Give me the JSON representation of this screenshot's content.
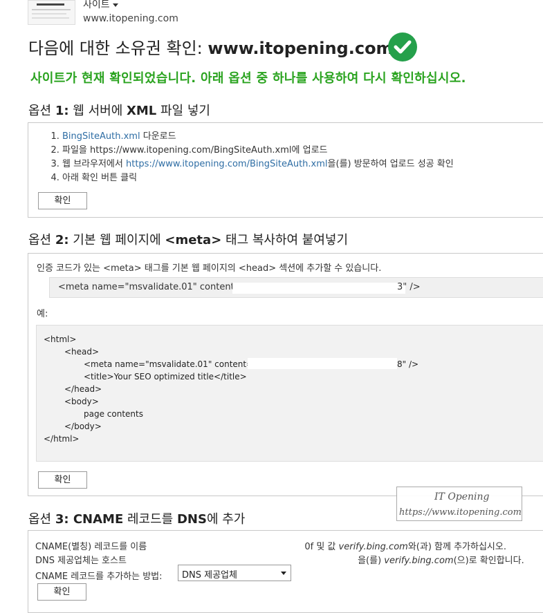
{
  "header": {
    "site_label": "사이트",
    "site_url": "www.itopening.com",
    "title_prefix": "다음에 대한 소유권 확인: ",
    "title_domain": "www.itopening.com",
    "banner": "사이트가 현재 확인되었습니다. 아래 옵션 중 하나를 사용하여 다시 확인하십시오."
  },
  "option1": {
    "heading_prefix": "옵션 ",
    "heading_num": "1:",
    "heading_text": " 웹 서버에 ",
    "heading_bold": "XML",
    "heading_suffix": " 파일 넣기",
    "step1_link": "BingSiteAuth.xml",
    "step1_text": " 다운로드",
    "step2": "파일을 https://www.itopening.com/BingSiteAuth.xml에 업로드",
    "step3_pre": "웹 브라우저에서 ",
    "step3_link": "https://www.itopening.com/BingSiteAuth.xml",
    "step3_post": "을(를) 방문하여 업로드 성공 확인",
    "step4": "아래 확인 버튼 클릭",
    "confirm": "확인"
  },
  "option2": {
    "heading_prefix": "옵션 ",
    "heading_num": "2:",
    "heading_text": " 기본 웹 페이지에 ",
    "heading_bold": "<meta>",
    "heading_suffix": " 태그 복사하여 붙여넣기",
    "intro": "인증 코드가 있는 <meta> 태그를 기본 웹 페이지의 <head> 섹션에 추가할 수 있습니다.",
    "meta_start": "<meta name=\"msvalidate.01\" content=\"",
    "meta_end": "3\" />",
    "example_label": "예:",
    "code": {
      "l1": "<html>",
      "l2": "<head>",
      "l3_start": "<meta name=\"msvalidate.01\" content=\"8",
      "l3_end": "8\" />",
      "l4": "<title>Your SEO optimized title</title>",
      "l5": "</head>",
      "l6": "<body>",
      "l7": "page contents",
      "l8": "</body>",
      "l9": "</html>"
    },
    "confirm": "확인"
  },
  "watermark": {
    "line1": "IT Opening",
    "line2": "https://www.itopening.com"
  },
  "option3": {
    "heading_prefix": "옵션 ",
    "heading_num": "3:",
    "heading_bold1": " CNAME",
    "heading_text": " 레코드를 ",
    "heading_bold2": "DNS",
    "heading_suffix": "에 추가",
    "line1_pre": "CNAME(별칭) 레코드를 이름 ",
    "line1_mid": "0f 및 값 ",
    "line1_value": "verify.bing.com",
    "line1_post": "와(과) 함께 추가하십시오.",
    "line2_pre": "DNS 제공업체는 호스트 ",
    "line2_mid": "을(를) ",
    "line2_value": "verify.bing.com",
    "line2_post": "(으)로 확인합니다.",
    "method_label": "CNAME 레코드를 추가하는 방법:",
    "method_value": "DNS 제공업체",
    "confirm": "확인"
  }
}
